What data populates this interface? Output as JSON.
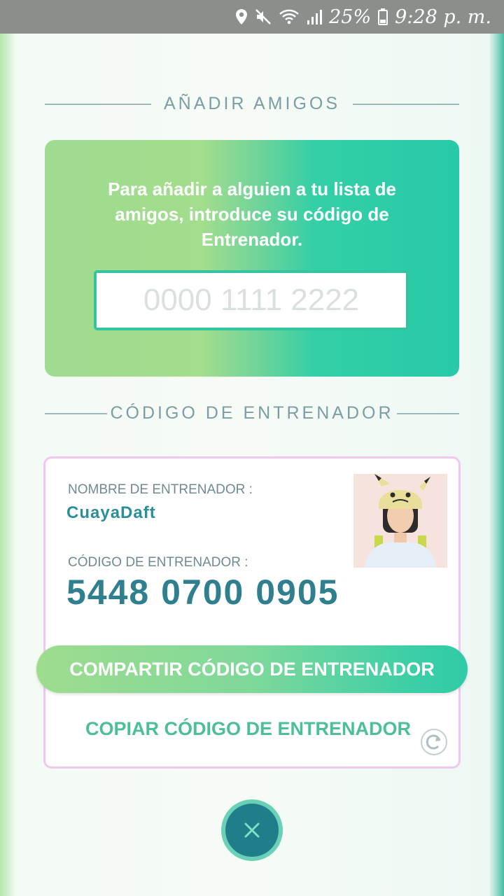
{
  "status_bar": {
    "battery": "25%",
    "time": "9:28 p. m."
  },
  "add_friends": {
    "title": "AÑADIR AMIGOS",
    "instructions": "Para añadir a alguien a tu lista de amigos, introduce su código de Entrenador.",
    "input_placeholder": "0000 1111 2222"
  },
  "trainer_code_section": {
    "title": "CÓDIGO DE ENTRENADOR",
    "name_label": "NOMBRE DE ENTRENADOR :",
    "name_value": "CuayaDaft",
    "code_label": "CÓDIGO DE ENTRENADOR :",
    "code_value": "5448 0700 0905",
    "share_button": "COMPARTIR CÓDIGO DE ENTRENADOR",
    "copy_button": "COPIAR CÓDIGO DE ENTRENADOR"
  },
  "icons": {
    "status": [
      "location-icon",
      "mute-icon",
      "wifi-icon",
      "signal-icon",
      "battery-icon"
    ],
    "copy": "refresh-icon",
    "close": "close-icon"
  },
  "colors": {
    "accent_green": "#27c9a9",
    "text_teal": "#2f7f8f",
    "close_button": "#1f7e8a"
  }
}
